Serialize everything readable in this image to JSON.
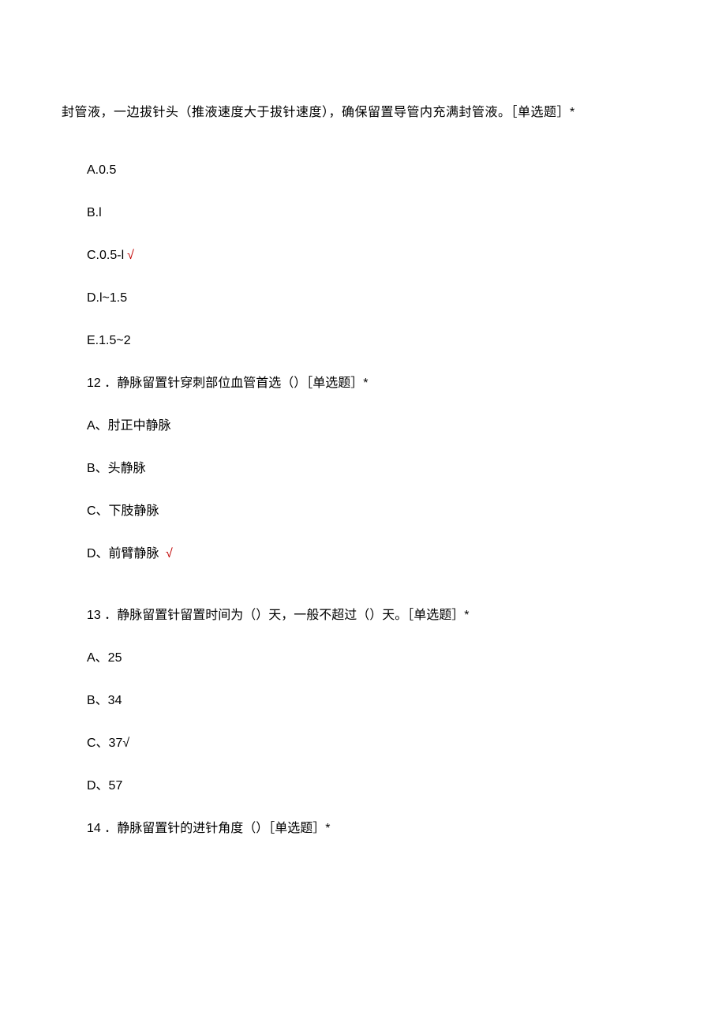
{
  "intro": "封管液，一边拔针头（推液速度大于拔针速度），确保留置导管内充满封管液。［单选题］*",
  "q11_options": {
    "a": "A.0.5",
    "b": "B.l",
    "c_prefix": "C.0.5-l",
    "c_mark": "√",
    "d": "D.l~1.5",
    "e": "E.1.5~2"
  },
  "q12": {
    "stem": "12 ．静脉留置针穿刺部位血管首选（）［单选题］*",
    "a": "A、肘正中静脉",
    "b": "B、头静脉",
    "c": "C、下肢静脉",
    "d_prefix": "D、前臂静脉",
    "d_mark": " √"
  },
  "q13": {
    "stem": "13 ．静脉留置针留置时间为（）天，一般不超过（）天。［单选题］*",
    "a": "A、25",
    "b": "B、34",
    "c": "C、37√",
    "d": "D、57"
  },
  "q14": {
    "stem": "14 ．静脉留置针的进针角度（）［单选题］*"
  }
}
